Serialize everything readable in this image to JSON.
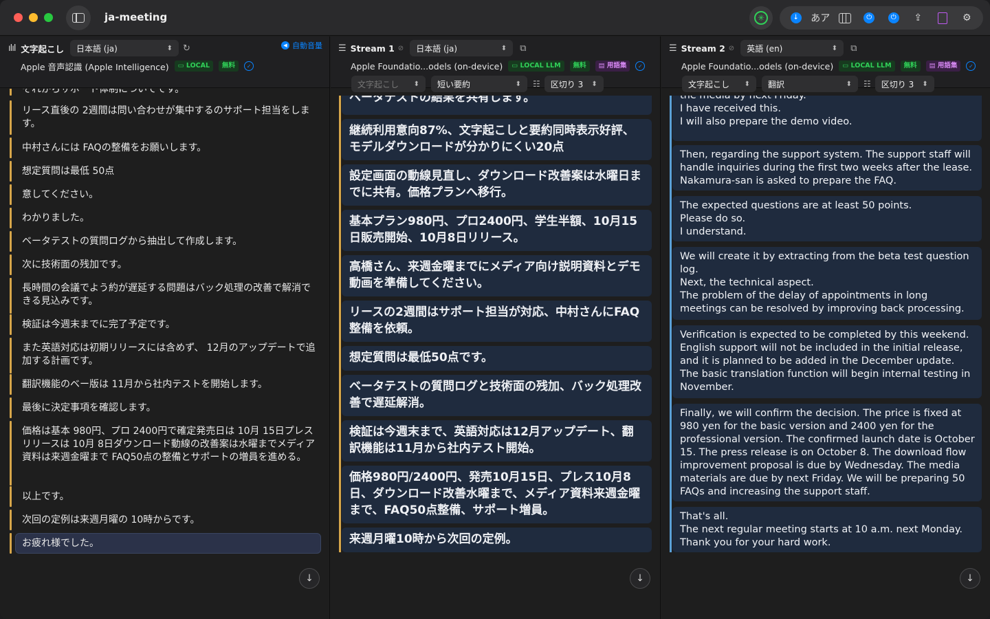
{
  "window": {
    "title": "ja-meeting"
  },
  "toolbar": {
    "kana_label": "あア"
  },
  "pane1": {
    "label": "文字起こし",
    "language": "日本語 (ja)",
    "auto_volume": "自動音量",
    "model": "Apple 音声認識 (Apple Intelligence)",
    "badge_local": "LOCAL",
    "badge_free": "無料",
    "items": [
      "それからサポート体制についてです。",
      "リース直後の 2週間は問い合わせが集中するのサポート担当をします。",
      "中村さんには FAQの整備をお願いします。",
      "想定質問は最低 50点",
      "意してください。",
      "わかりました。",
      "ベータテストの質問ログから抽出して作成します。",
      "次に技術面の残加です。",
      "長時間の会議でよう約が遅延する問題はバック処理の改善で解消できる見込みです。",
      "検証は今週末までに完了予定です。",
      "また英語対応は初期リリースには含めず、 12月のアップデートで追加する計画です。",
      "翻訳機能のベー版は 11月から社内テストを開始します。",
      "最後に決定事項を確認します。",
      "価格は基本 980円、プロ 2400円で確定発売日は 10月 15日プレスリリースは 10月 8日ダウンロード動線の改善案は水曜までメディア資料は来週金曜まで FAQ50点の整備とサポートの増員を進める。",
      "以上です。",
      "次回の定例は来週月曜の 10時からです。",
      "お疲れ様でした。"
    ]
  },
  "pane2": {
    "label": "Stream 1",
    "language": "日本語 (ja)",
    "model": "Apple Foundatio...odels (on-device)",
    "badge_local": "LOCAL LLM",
    "badge_free": "無料",
    "badge_gloss": "用語集",
    "source": "文字起こし",
    "mode": "短い要約",
    "split": "区切り 3",
    "items": [
      "ベータテストの結果を共有します。",
      "継続利用意向87%、文字起こしと要約同時表示好評、モデルダウンロードが分かりにくい20点",
      "設定画面の動線見直し、ダウンロード改善案は水曜日までに共有。価格プランへ移行。",
      "基本プラン980円、プロ2400円、学生半額、10月15日販売開始、10月8日リリース。",
      "高橋さん、来週金曜までにメディア向け説明資料とデモ動画を準備してください。",
      "リースの2週間はサポート担当が対応、中村さんにFAQ整備を依頼。",
      "想定質問は最低50点です。",
      "ベータテストの質問ログと技術面の残加、バック処理改善で遅延解消。",
      "検証は今週末まで、英語対応は12月アップデート、翻訳機能は11月から社内テスト開始。",
      "価格980円/2400円、発売10月15日、プレス10月8日、ダウンロード改善水曜まで、メディア資料来週金曜まで、FAQ50点整備、サポート増員。",
      "来週月曜10時から次回の定例。"
    ]
  },
  "pane3": {
    "label": "Stream 2",
    "language": "英語 (en)",
    "model": "Apple Foundatio...odels (on-device)",
    "badge_local": "LOCAL LLM",
    "badge_free": "無料",
    "badge_gloss": "用語集",
    "source": "文字起こし",
    "mode": "翻訳",
    "split": "区切り 3",
    "items": [
      "the media by next Friday.\nI have received this.\nI will also prepare the demo video.",
      "Then, regarding the support system. The support staff will handle inquiries during the first two weeks after the lease. Nakamura-san is asked to prepare the FAQ.",
      "The expected questions are at least 50 points.\nPlease do so.\nI understand.",
      "We will create it by extracting from the beta test question log.\nNext, the technical aspect.\nThe problem of the delay of appointments in long meetings can be resolved by improving back processing.",
      "Verification is expected to be completed by this weekend. English support will not be included in the initial release, and it is planned to be added in the December update.\nThe basic translation function will begin internal testing in November.",
      "Finally, we will confirm the decision. The price is fixed at 980 yen for the basic version and 2400 yen for the professional version. The confirmed launch date is October 15. The press release is on October 8. The download flow improvement proposal is due by Wednesday. The media materials are due by next Friday. We will be preparing 50 FAQs and increasing the support staff.",
      "That's all.\nThe next regular meeting starts at 10 a.m. next Monday.\nThank you for your hard work."
    ]
  }
}
